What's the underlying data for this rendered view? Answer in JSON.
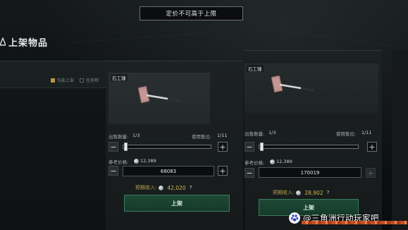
{
  "toast": {
    "text": "定价不可高于上限"
  },
  "page": {
    "title": "上架物品"
  },
  "filters": [
    {
      "label": "仅能上架",
      "checked": true
    },
    {
      "label": "任务物",
      "checked": false
    }
  ],
  "listings": [
    {
      "item_name": "石工锤",
      "sell_qty_label": "出售数量:",
      "sell_qty_value": "1/3",
      "slots_label": "使用售位:",
      "slots_value": "1/11",
      "qty_fraction": 0.0,
      "ref_price_label": "参考价格:",
      "ref_price_value": "12,389",
      "price_input": "68083",
      "income_label": "预期收入:",
      "income_value": "42,020",
      "help": "?",
      "list_button": "上架",
      "plus_enabled": true
    },
    {
      "item_name": "石工锤",
      "sell_qty_label": "出售数量:",
      "sell_qty_value": "1/3",
      "slots_label": "使用售位:",
      "slots_value": "1/11",
      "qty_fraction": 0.0,
      "ref_price_label": "参考价格:",
      "ref_price_value": "12,389",
      "price_input": "170019",
      "income_label": "预期收入:",
      "income_value": "28,902",
      "help": "?",
      "list_button": "上架",
      "plus_enabled": false
    }
  ],
  "controls": {
    "minus": "−",
    "plus": "+"
  },
  "watermark": {
    "text": "@三角洲行动玩家吧"
  },
  "colors": {
    "accent_gold": "#d6b84f",
    "list_button": "#1e4836",
    "filter_on": "#b49845"
  }
}
